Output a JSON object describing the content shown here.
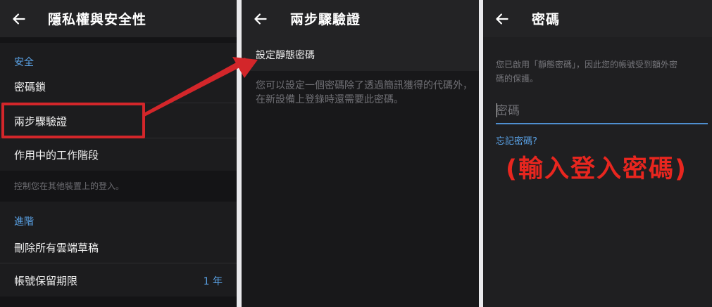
{
  "colors": {
    "accent": "#5aa2e6",
    "highlight_red": "#d3262a",
    "background": "#1c1c1e"
  },
  "panel1": {
    "back_icon": "arrow-left-icon",
    "title": "隱私權與安全性",
    "section_security": "安全",
    "passcode_lock": "密碼鎖",
    "two_step": "兩步驟驗證",
    "active_sessions": "作用中的工作階段",
    "sessions_hint": "控制您在其他裝置上的登入。",
    "section_advanced": "進階",
    "delete_drafts": "刪除所有雲端草稿",
    "account_ttl": "帳號保留期限",
    "account_ttl_value": "1 年"
  },
  "panel2": {
    "back_icon": "arrow-left-icon",
    "title": "兩步驟驗證",
    "set_password": "設定靜態密碼",
    "description_line1": "您可以設定一個密碼除了透過簡訊獲得的代碼外，",
    "description_line2": "在新設備上登錄時還需要此密碼。"
  },
  "panel3": {
    "back_icon": "arrow-left-icon",
    "title": "密碼",
    "info_line1": "您已啟用「靜態密碼」，因此您的帳號受到額外密",
    "info_line2": "碼的保護。",
    "password_placeholder": "密碼",
    "forgot_password": "忘記密碼?",
    "annotation": "(輸入登入密碼)"
  }
}
